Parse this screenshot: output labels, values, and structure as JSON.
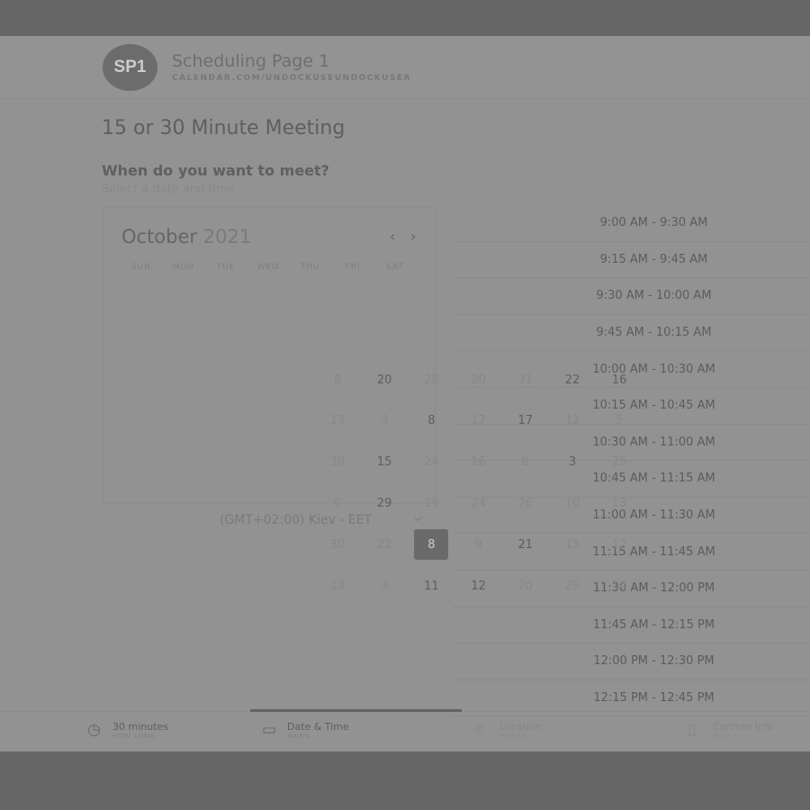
{
  "header": {
    "avatar": "SP1",
    "title": "Scheduling Page 1",
    "url": "CALENDAR.COM/UNDOCKUSEUNDOCKUSER"
  },
  "meeting_title": "15 or 30 Minute Meeting",
  "question": "When do you want to meet?",
  "subtitle": "Select a date and time",
  "calendar": {
    "month": "October",
    "year": "2021",
    "prev": "‹",
    "next": "›",
    "weekdays": [
      "SUN",
      "MON",
      "TUE",
      "WED",
      "THU",
      "FRI",
      "SAT"
    ],
    "rows": [
      [
        {
          "d": "8",
          "f": 1
        },
        {
          "d": "20"
        },
        {
          "d": "28",
          "f": 1
        },
        {
          "d": "20",
          "f": 1
        },
        {
          "d": "31",
          "f": 1
        },
        {
          "d": "22"
        },
        {
          "d": "16"
        }
      ],
      [
        {
          "d": "13",
          "f": 1
        },
        {
          "d": "3",
          "f": 1
        },
        {
          "d": "8"
        },
        {
          "d": "17",
          "f": 1
        },
        {
          "d": "17"
        },
        {
          "d": "12",
          "f": 1
        },
        {
          "d": "5",
          "f": 1
        }
      ],
      [
        {
          "d": "30",
          "f": 1
        },
        {
          "d": "15"
        },
        {
          "d": "24",
          "f": 1
        },
        {
          "d": "16",
          "f": 1
        },
        {
          "d": "8",
          "f": 1
        },
        {
          "d": "3"
        },
        {
          "d": "25",
          "f": 1
        }
      ],
      [
        {
          "d": "6",
          "f": 1
        },
        {
          "d": "29"
        },
        {
          "d": "19",
          "f": 1
        },
        {
          "d": "24",
          "f": 1
        },
        {
          "d": "26",
          "f": 1
        },
        {
          "d": "10",
          "f": 1
        },
        {
          "d": "13",
          "f": 1
        }
      ],
      [
        {
          "d": "30",
          "f": 1
        },
        {
          "d": "22",
          "f": 1
        },
        {
          "d": "8",
          "sel": 1
        },
        {
          "d": "9",
          "f": 1
        },
        {
          "d": "21"
        },
        {
          "d": "13",
          "f": 1
        },
        {
          "d": "12",
          "f": 1
        }
      ],
      [
        {
          "d": "18",
          "f": 1
        },
        {
          "d": "3",
          "f": 1
        },
        {
          "d": "11"
        },
        {
          "d": "12"
        },
        {
          "d": "20",
          "f": 1
        },
        {
          "d": "25",
          "f": 1
        },
        {
          "d": "14",
          "f": 1
        }
      ]
    ]
  },
  "timezone": "(GMT+02:00) Kiev - EET",
  "slots": [
    "9:00 AM - 9:30 AM",
    "9:15 AM - 9:45 AM",
    "9:30 AM - 10:00 AM",
    "9:45 AM - 10:15 AM",
    "10:00 AM - 10:30 AM",
    "10:15 AM - 10:45 AM",
    "10:30 AM - 11:00 AM",
    "10:45 AM - 11:15 AM",
    "11:00 AM - 11:30 AM",
    "11:15 AM - 11:45 AM",
    "11:30 AM - 12:00 PM",
    "11:45 AM - 12:15 PM",
    "12:00 PM - 12:30 PM",
    "12:15 PM - 12:45 PM"
  ],
  "steps": [
    {
      "icon": "clock-icon",
      "glyph": "◷",
      "label": "30 minutes",
      "sub": "HOW LONG"
    },
    {
      "icon": "calendar-icon",
      "glyph": "▭",
      "label": "Date & Time",
      "sub": "WHEN"
    },
    {
      "icon": "location-pin-icon",
      "glyph": "⌾",
      "label": "Location",
      "sub": "WHERE"
    },
    {
      "icon": "document-icon",
      "glyph": "▯",
      "label": "Confirm Info",
      "sub": "WHO"
    }
  ]
}
